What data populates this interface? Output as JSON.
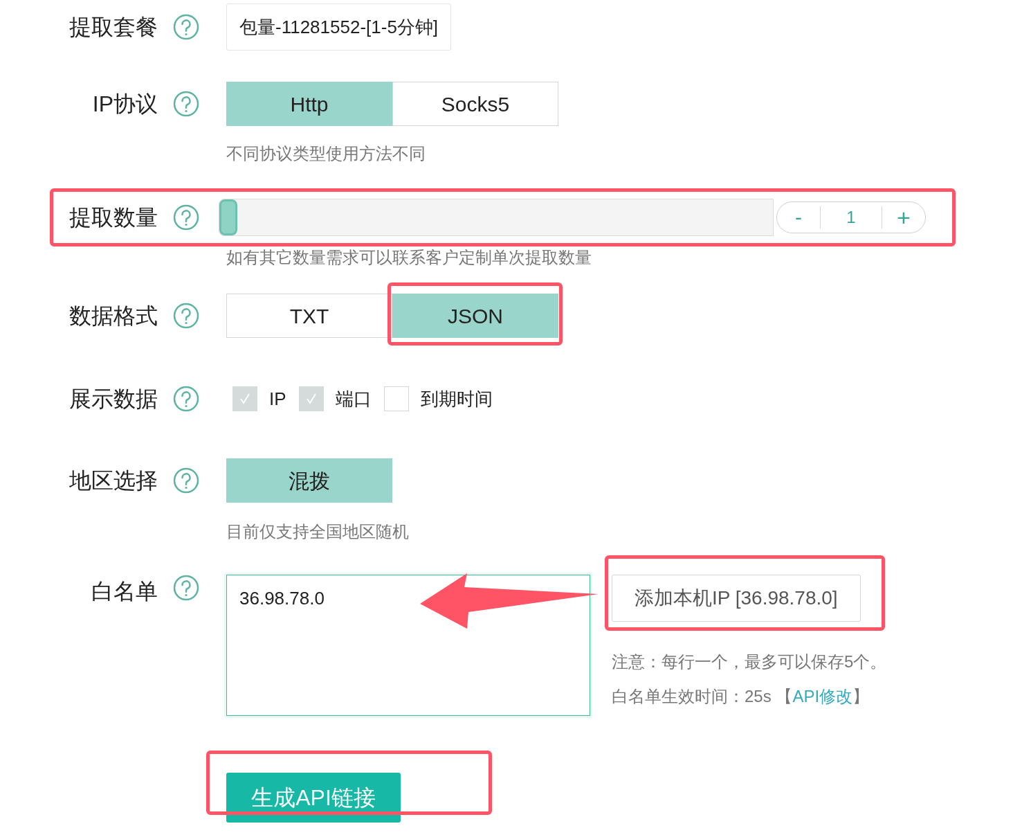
{
  "package": {
    "label": "提取套餐",
    "value": "包量-11281552-[1-5分钟]"
  },
  "protocol": {
    "label": "IP协议",
    "options": [
      {
        "label": "Http",
        "selected": true
      },
      {
        "label": "Socks5",
        "selected": false
      }
    ],
    "hint": "不同协议类型使用方法不同"
  },
  "quantity": {
    "label": "提取数量",
    "level": 0,
    "minus": "-",
    "value": "1",
    "plus": "+",
    "hint": "如有其它数量需求可以联系客户定制单次提取数量"
  },
  "format": {
    "label": "数据格式",
    "options": [
      {
        "label": "TXT",
        "selected": false
      },
      {
        "label": "JSON",
        "selected": true
      }
    ]
  },
  "display": {
    "label": "展示数据",
    "options": [
      {
        "label": "IP",
        "checked": true
      },
      {
        "label": "端口",
        "checked": true
      },
      {
        "label": "到期时间",
        "checked": false
      }
    ]
  },
  "region": {
    "label": "地区选择",
    "options": [
      {
        "label": "混拨",
        "selected": true
      }
    ],
    "hint": "目前仅支持全国地区随机"
  },
  "whitelist": {
    "label": "白名单",
    "value": "36.98.78.0",
    "add_button": "添加本机IP [36.98.78.0]",
    "note": "注意：每行一个，最多可以保存5个。",
    "effect_text": "白名单生效时间：25s 【",
    "link": "API修改",
    "effect_end": "】"
  },
  "generate_button": "生成API链接"
}
